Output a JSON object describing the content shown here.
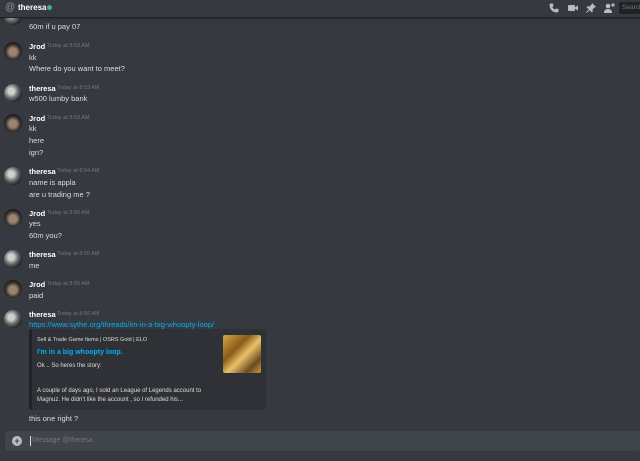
{
  "header": {
    "at_symbol": "@",
    "channel_name": "theresa",
    "search_placeholder": "Search"
  },
  "composer": {
    "placeholder": "Message @theresa",
    "plus": "+"
  },
  "messages": [
    {
      "lines": [
        "60m if u pay 07"
      ]
    },
    {
      "author": "Jrod",
      "time": "Today at 8:53 AM",
      "lines": [
        "kk",
        "Where do you want to meet?"
      ]
    },
    {
      "author": "theresa",
      "time": "Today at 8:53 AM",
      "lines": [
        "w500 lumby bank"
      ]
    },
    {
      "author": "Jrod",
      "time": "Today at 8:53 AM",
      "lines": [
        "kk",
        "here",
        "ign?"
      ]
    },
    {
      "author": "theresa",
      "time": "Today at 8:54 AM",
      "lines": [
        "name is appla",
        "are u trading me ?"
      ]
    },
    {
      "author": "Jrod",
      "time": "Today at 8:55 AM",
      "lines": [
        "yes",
        "60m you?"
      ]
    },
    {
      "author": "theresa",
      "time": "Today at 8:55 AM",
      "lines": [
        "me"
      ]
    },
    {
      "author": "Jrod",
      "time": "Today at 8:55 AM",
      "lines": [
        "paid"
      ]
    },
    {
      "author": "theresa",
      "time": "Today at 8:56 AM",
      "link": "https://www.sythe.org/threads/im-in-a-big-whoopty-loop/",
      "embed": {
        "provider": "Sell & Trade Game Items | OSRS Gold | ELO",
        "title": "I'm in a big whoopty loop.",
        "desc1": "Ok .. So heres the story:",
        "desc2": "A couple of days ago, I sold an League of Legends account to Magnuz. He didn't like the account , so I refunded his..."
      },
      "after": "this one right ?"
    }
  ]
}
